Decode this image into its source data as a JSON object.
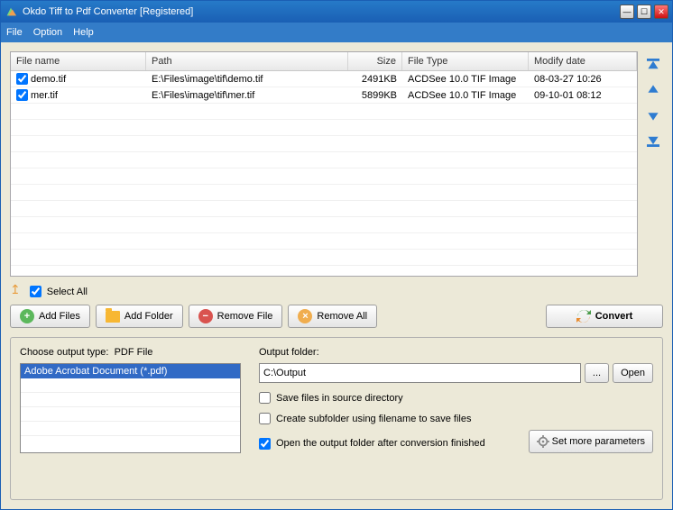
{
  "title": "Okdo Tiff to Pdf Converter [Registered]",
  "menu": {
    "file": "File",
    "option": "Option",
    "help": "Help"
  },
  "columns": {
    "name": "File name",
    "path": "Path",
    "size": "Size",
    "type": "File Type",
    "date": "Modify date"
  },
  "files": [
    {
      "checked": true,
      "name": "demo.tif",
      "path": "E:\\Files\\image\\tif\\demo.tif",
      "size": "2491KB",
      "type": "ACDSee 10.0 TIF Image",
      "date": "08-03-27 10:26"
    },
    {
      "checked": true,
      "name": "mer.tif",
      "path": "E:\\Files\\image\\tif\\mer.tif",
      "size": "5899KB",
      "type": "ACDSee 10.0 TIF Image",
      "date": "09-10-01 08:12"
    }
  ],
  "selectAll": {
    "label": "Select All",
    "checked": true
  },
  "buttons": {
    "addFiles": "Add Files",
    "addFolder": "Add Folder",
    "removeFile": "Remove File",
    "removeAll": "Remove All",
    "convert": "Convert"
  },
  "outputType": {
    "label": "Choose output type:",
    "current": "PDF File",
    "selected": "Adobe Acrobat Document (*.pdf)"
  },
  "outputFolder": {
    "label": "Output folder:",
    "value": "C:\\Output",
    "browse": "...",
    "open": "Open"
  },
  "options": {
    "saveInSource": {
      "label": "Save files in source directory",
      "checked": false
    },
    "subfolder": {
      "label": "Create subfolder using filename to save files",
      "checked": false
    },
    "openAfter": {
      "label": "Open the output folder after conversion finished",
      "checked": true
    }
  },
  "moreParams": "Set more parameters"
}
